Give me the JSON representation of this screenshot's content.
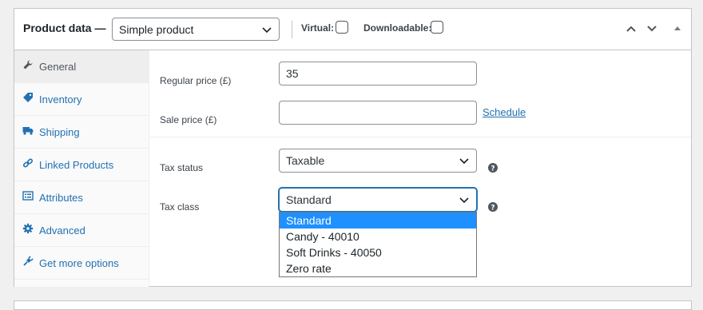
{
  "header": {
    "title": "Product data —",
    "product_type": "Simple product",
    "virtual_label": "Virtual:",
    "downloadable_label": "Downloadable:"
  },
  "tabs": [
    {
      "label": "General",
      "icon": "wrench-icon"
    },
    {
      "label": "Inventory",
      "icon": "tag-icon"
    },
    {
      "label": "Shipping",
      "icon": "truck-icon"
    },
    {
      "label": "Linked Products",
      "icon": "link-icon"
    },
    {
      "label": "Attributes",
      "icon": "list-icon"
    },
    {
      "label": "Advanced",
      "icon": "gear-icon"
    },
    {
      "label": "Get more options",
      "icon": "plugin-icon"
    }
  ],
  "fields": {
    "regular_price_label": "Regular price (£)",
    "regular_price_value": "35",
    "sale_price_label": "Sale price (£)",
    "sale_price_value": "",
    "schedule_link": "Schedule",
    "tax_status_label": "Tax status",
    "tax_status_value": "Taxable",
    "tax_class_label": "Tax class",
    "tax_class_value": "Standard"
  },
  "tax_class_options": [
    "Standard",
    "Candy - 40010",
    "Soft Drinks - 40050",
    "Zero rate"
  ],
  "colors": {
    "accent": "#2271b1",
    "highlight": "#1e90ff"
  }
}
